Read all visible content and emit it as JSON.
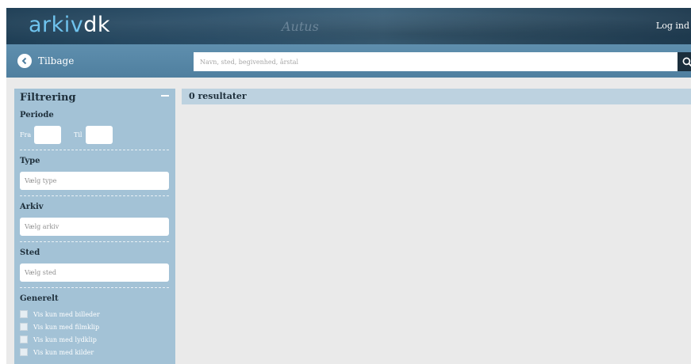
{
  "header": {
    "logo_part1": "arkiv",
    "logo_part2": "dk",
    "script_text": "Autus",
    "login_label": "Log ind"
  },
  "toolbar": {
    "back_label": "Tilbage",
    "search_placeholder": "Navn, sted, begivenhed, årstal"
  },
  "filter": {
    "title": "Filtrering",
    "periode": {
      "label": "Periode",
      "from_label": "Fra",
      "to_label": "Til"
    },
    "type": {
      "label": "Type",
      "placeholder": "Vælg type"
    },
    "arkiv": {
      "label": "Arkiv",
      "placeholder": "Vælg arkiv"
    },
    "sted": {
      "label": "Sted",
      "placeholder": "Vælg sted"
    },
    "generelt": {
      "label": "Generelt",
      "options": [
        "Vis kun med billeder",
        "Vis kun med filmklip",
        "Vis kun med lydklip",
        "Vis kun med kilder"
      ]
    }
  },
  "results": {
    "label": "0 resultater"
  },
  "colors": {
    "logo_accent": "#6fc3ee",
    "sidebar": "#a3c2d6",
    "results_bar": "#bdd2e0",
    "search_button": "#1b2e3c"
  }
}
